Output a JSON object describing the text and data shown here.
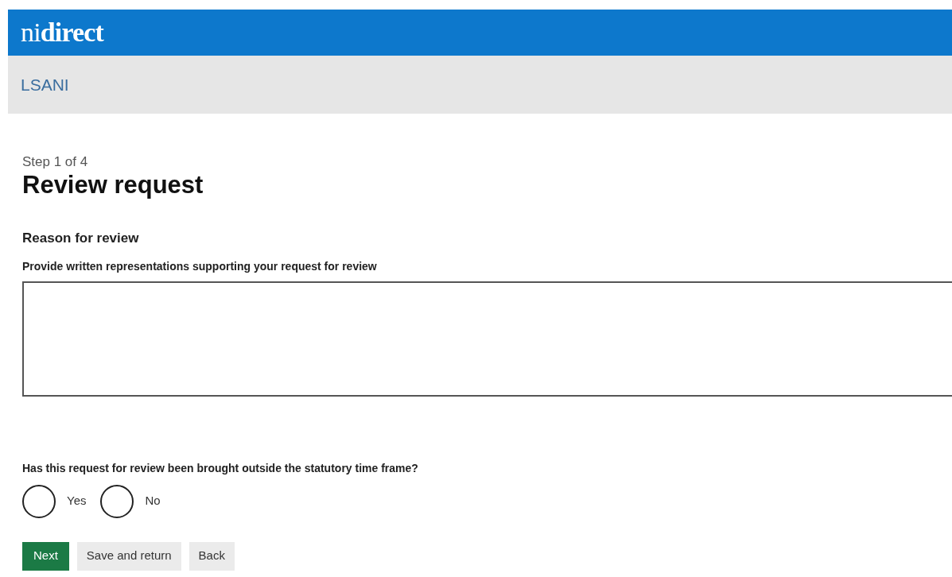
{
  "header": {
    "logo": "ni**direct**"
  },
  "subheader": {
    "title": "LSANI"
  },
  "step": "Step 1 of 4",
  "title": "Review request",
  "section": "Reason for review",
  "textarea": {
    "label": "Provide written representations supporting your request for review"
  },
  "question": {
    "label": "Has this request for review been brought outside the statutory time frame?",
    "options": [
      {
        "label": "Yes",
        "selected": false
      },
      {
        "label": "No",
        "selected": false
      }
    ]
  },
  "buttons": [
    {
      "label": "Next",
      "kind": "primary"
    },
    {
      "label": "Save and return",
      "kind": "secondary"
    },
    {
      "label": "Back",
      "kind": "secondary"
    }
  ]
}
